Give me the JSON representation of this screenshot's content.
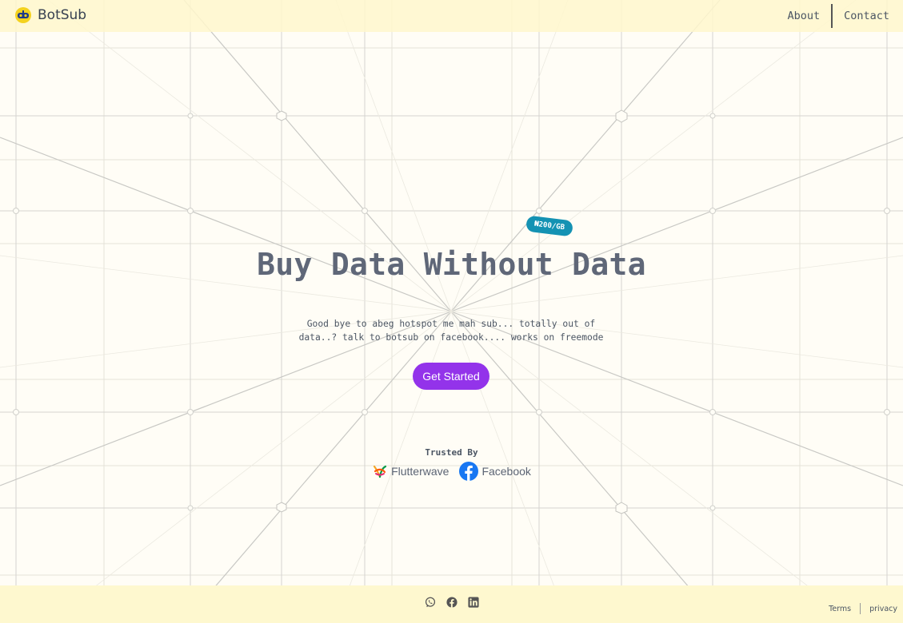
{
  "brand": {
    "name": "BotSub"
  },
  "nav": {
    "about": "About",
    "contact": "Contact"
  },
  "hero": {
    "price_tag": "₦200/GB",
    "title": "Buy Data Without Data",
    "subtitle": "Good bye to abeg hotspot me mah sub... totally out of data..? talk to botsub on facebook.... works on freemode",
    "cta": "Get Started"
  },
  "trusted": {
    "label": "Trusted By",
    "partners": [
      {
        "name": "Flutterwave",
        "icon": "flutterwave-icon"
      },
      {
        "name": "Facebook",
        "icon": "facebook-icon"
      }
    ]
  },
  "footer": {
    "socials": [
      "whatsapp-icon",
      "facebook-icon",
      "linkedin-icon"
    ],
    "terms": "Terms",
    "privacy": "privacy"
  },
  "colors": {
    "background": "#fffdf6",
    "topbar": "#fff7cd",
    "footer": "#fef8cf",
    "accent": "#9333ea",
    "tag": "#1492b3",
    "title": "#5f6778"
  }
}
